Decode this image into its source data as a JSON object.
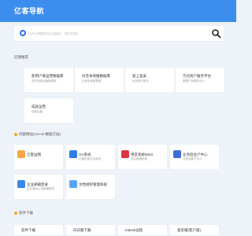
{
  "header": {
    "title": "亿客导航"
  },
  "search": {
    "placeholder": "站内公家搜导航后台搜索的，请您先搜索"
  },
  "sections": [
    {
      "title": "近期推荐"
    },
    {
      "title": "内部网站(CH+D-数据万站)"
    },
    {
      "title": "软件下载"
    }
  ],
  "recommend": [
    {
      "name": "新用户来运营数据库",
      "desc": "实时开库运营数据库"
    },
    {
      "name": "抖音本地推数据库",
      "desc": "抖音本地推数据"
    },
    {
      "name": "爱上鉴美",
      "desc": "优秀修订助手"
    },
    {
      "name": "万达商户服务平台",
      "desc": "数据产品服务中心"
    },
    {
      "name": "成就运营",
      "desc": "成就运营"
    }
  ],
  "internal": [
    {
      "name": "亿客运网",
      "desc": "",
      "logo_color": "#f7a54a"
    },
    {
      "name": "OA系统",
      "desc": "亿要信息平台系统",
      "logo_color": "#2f7de1"
    },
    {
      "name": "用友系统8004",
      "desc": "用友管理系统",
      "logo_color": "#d9363e"
    },
    {
      "name": "业务后台户中心",
      "desc": "业务运营户中心",
      "logo_color": "#3b6fd4"
    },
    {
      "name": "企业邮箱登录",
      "desc": "企业通讯公司邮箱登录",
      "logo_color": "#3b87e6"
    },
    {
      "name": "文档组织管理系统",
      "desc": "",
      "logo_color": "#5aa5f0"
    }
  ],
  "downloads": [
    {
      "name": "软件下载"
    },
    {
      "name": "向日葵下载"
    },
    {
      "name": "todesk远程"
    },
    {
      "name": "爱剪辑(客户版)"
    }
  ],
  "colors": {
    "accent": "#3d8dee",
    "background": "#eef3f9"
  }
}
